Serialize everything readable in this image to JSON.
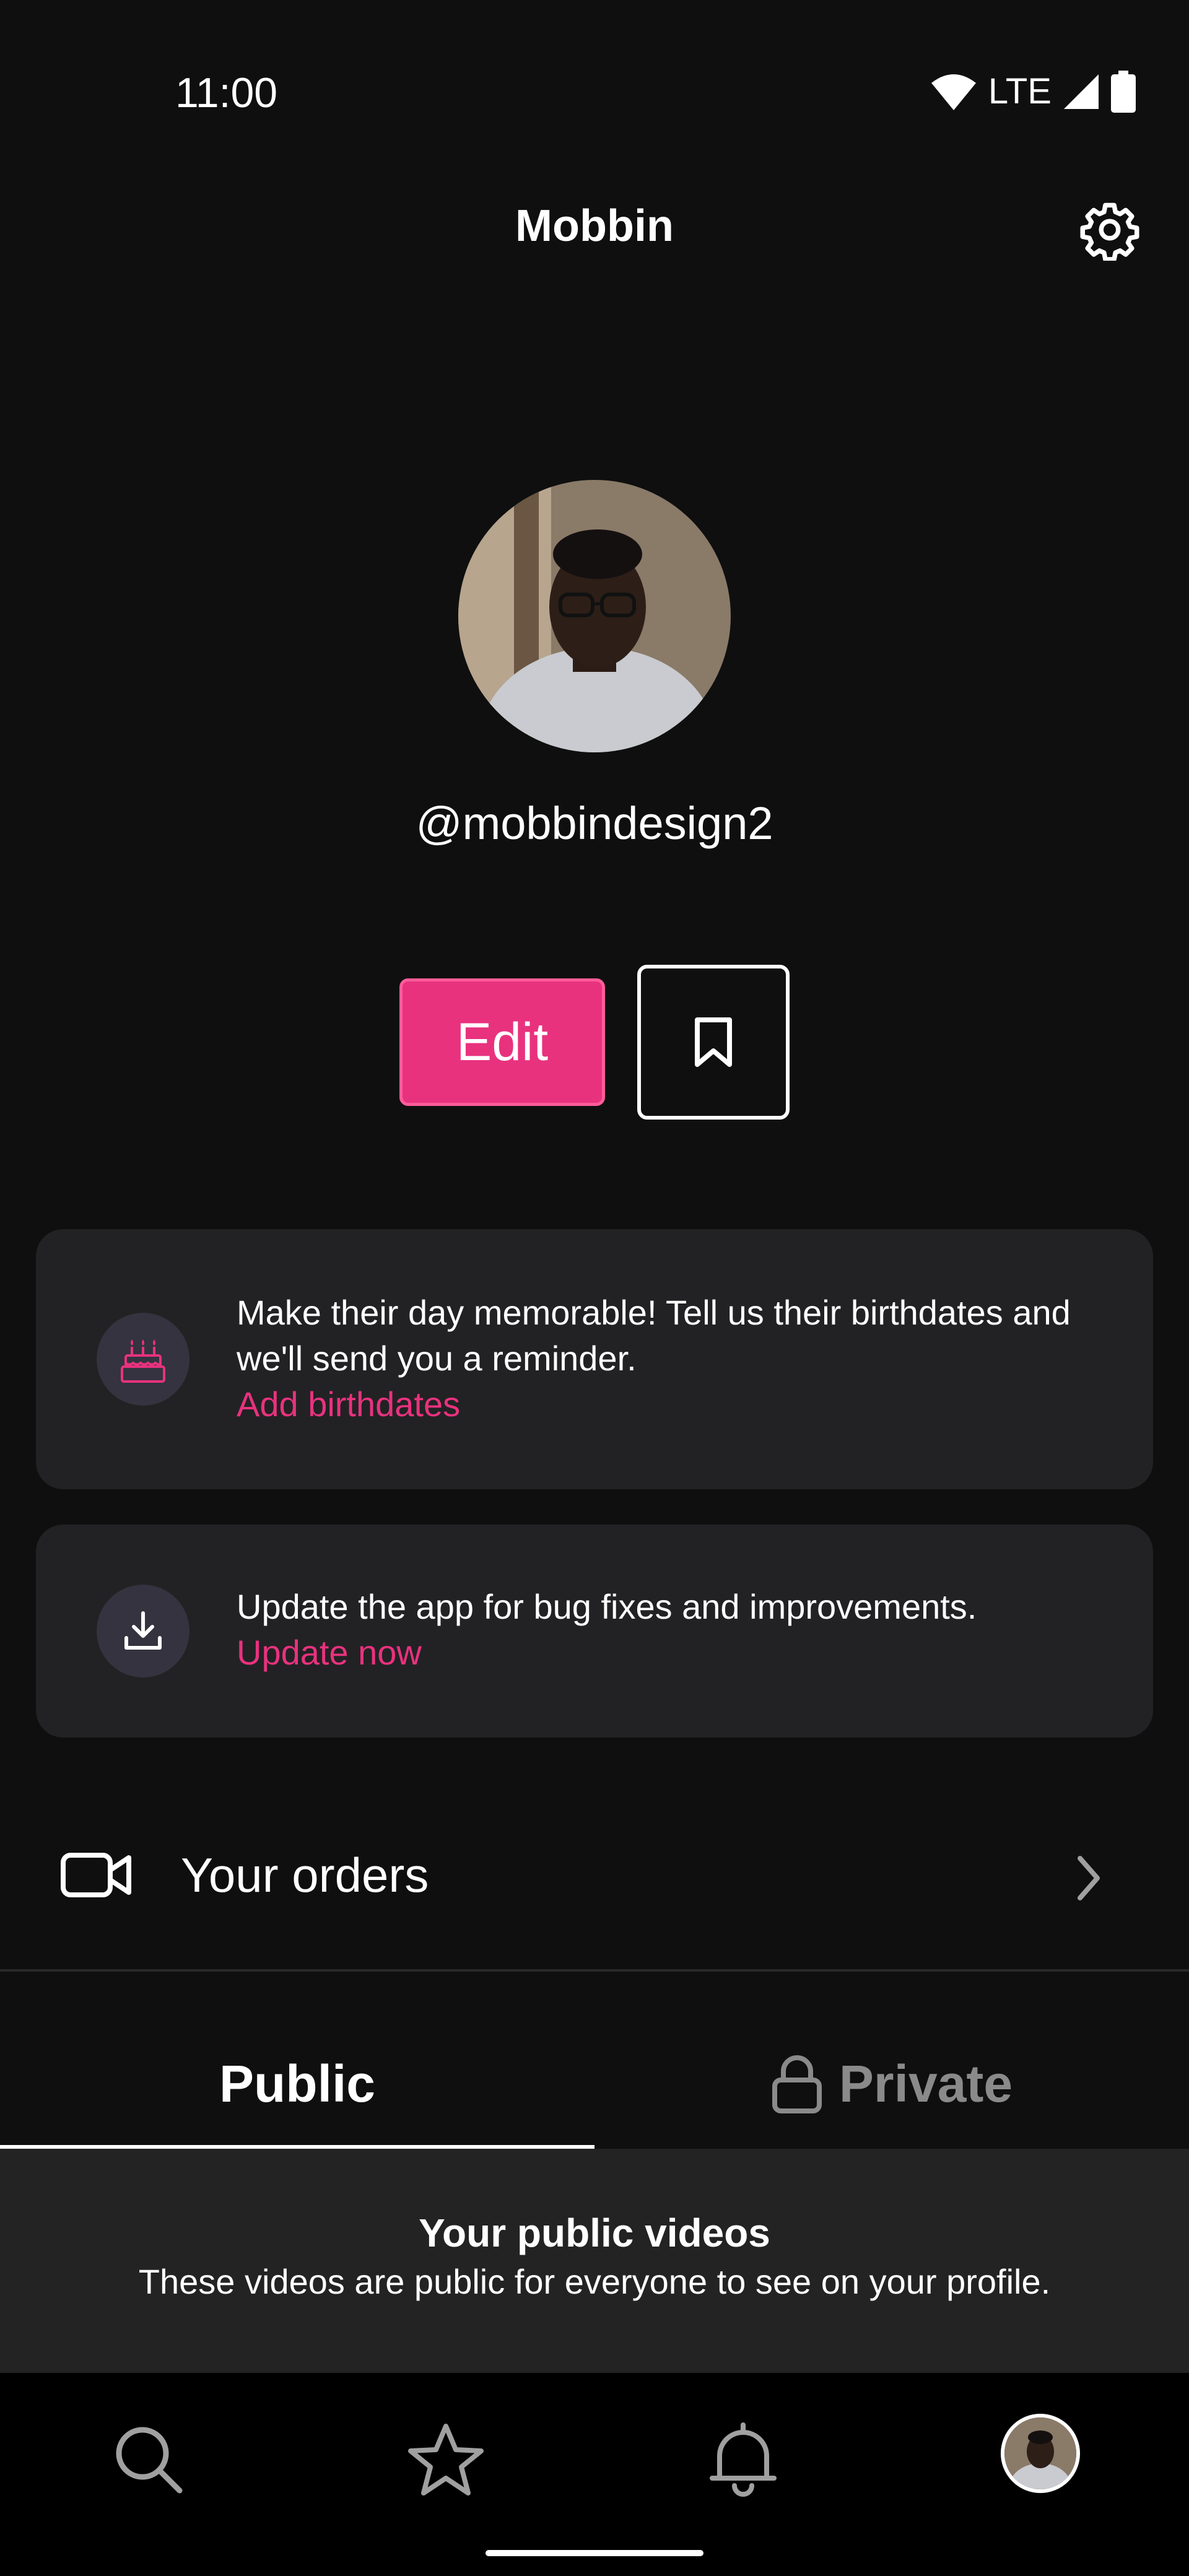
{
  "status_bar": {
    "time": "11:00",
    "network": "LTE",
    "icons": [
      "wifi-icon",
      "signal-icon",
      "battery-icon"
    ]
  },
  "header": {
    "title": "Mobbin",
    "settings_icon": "gear-icon"
  },
  "profile": {
    "username": "@mobbindesign2",
    "edit_label": "Edit",
    "bookmark_icon": "bookmark-icon"
  },
  "cards": {
    "birthday": {
      "icon": "cake-icon",
      "text": "Make their day memorable! Tell us their birthdates and we'll send you a reminder.",
      "link": "Add birthdates"
    },
    "update": {
      "icon": "download-icon",
      "text": "Update the app for bug fixes and improvements.",
      "link": "Update now"
    }
  },
  "orders": {
    "icon": "video-camera-icon",
    "label": "Your orders",
    "chevron_icon": "chevron-right-icon"
  },
  "tabs": {
    "public": "Public",
    "private": "Private",
    "active": "Public"
  },
  "panel": {
    "title": "Your public videos",
    "subtitle": "These videos are public for everyone to see on your profile."
  },
  "bottom_nav": {
    "items": [
      "search-icon",
      "star-icon",
      "bell-icon",
      "profile-avatar"
    ]
  },
  "colors": {
    "background": "#0f0f0f",
    "accent": "#e8327e",
    "card": "#222224",
    "muted": "#8a8a8a"
  }
}
